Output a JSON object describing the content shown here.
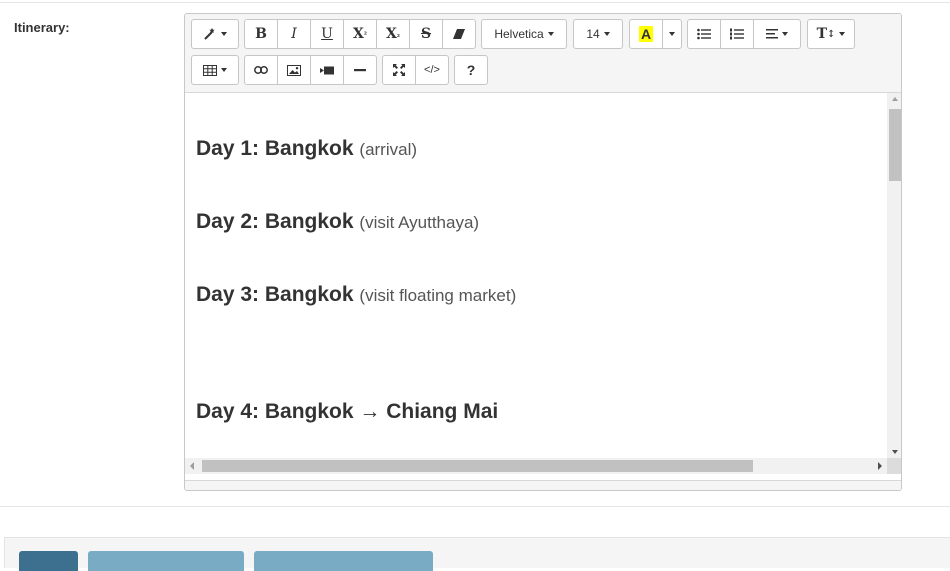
{
  "form": {
    "itinerary_label": "Itinerary:"
  },
  "toolbar": {
    "style_icon": "magic-wand-icon",
    "bold_label": "B",
    "italic_label": "I",
    "underline_label": "U",
    "superscript_label": "X",
    "subscript_label": "X",
    "strikethrough_label": "S",
    "eraser_icon": "eraser-icon",
    "font_name": "Helvetica",
    "font_size": "14",
    "color_label": "A",
    "highlight_color": "#ffff00",
    "ul_icon": "unordered-list-icon",
    "ol_icon": "ordered-list-icon",
    "align_icon": "align-icon",
    "height_label": "T",
    "table_icon": "table-icon",
    "link_icon": "link-icon",
    "picture_icon": "picture-icon",
    "video_icon": "video-icon",
    "hr_icon": "horizontal-rule-icon",
    "fullscreen_icon": "fullscreen-icon",
    "code_label": "</>",
    "help_label": "?"
  },
  "content": {
    "days": [
      {
        "title": "Day 1: Bangkok",
        "note": "(arrival)"
      },
      {
        "title": "Day 2: Bangkok",
        "note": "(visit Ayutthaya)"
      },
      {
        "title": "Day 3: Bangkok",
        "note": "(visit floating market)"
      },
      {
        "title": "Day 4: Bangkok → Chiang Mai",
        "note": ""
      }
    ]
  },
  "colors": {
    "footer_primary": "#3d6f8e",
    "footer_secondary": "#7aabc4"
  }
}
